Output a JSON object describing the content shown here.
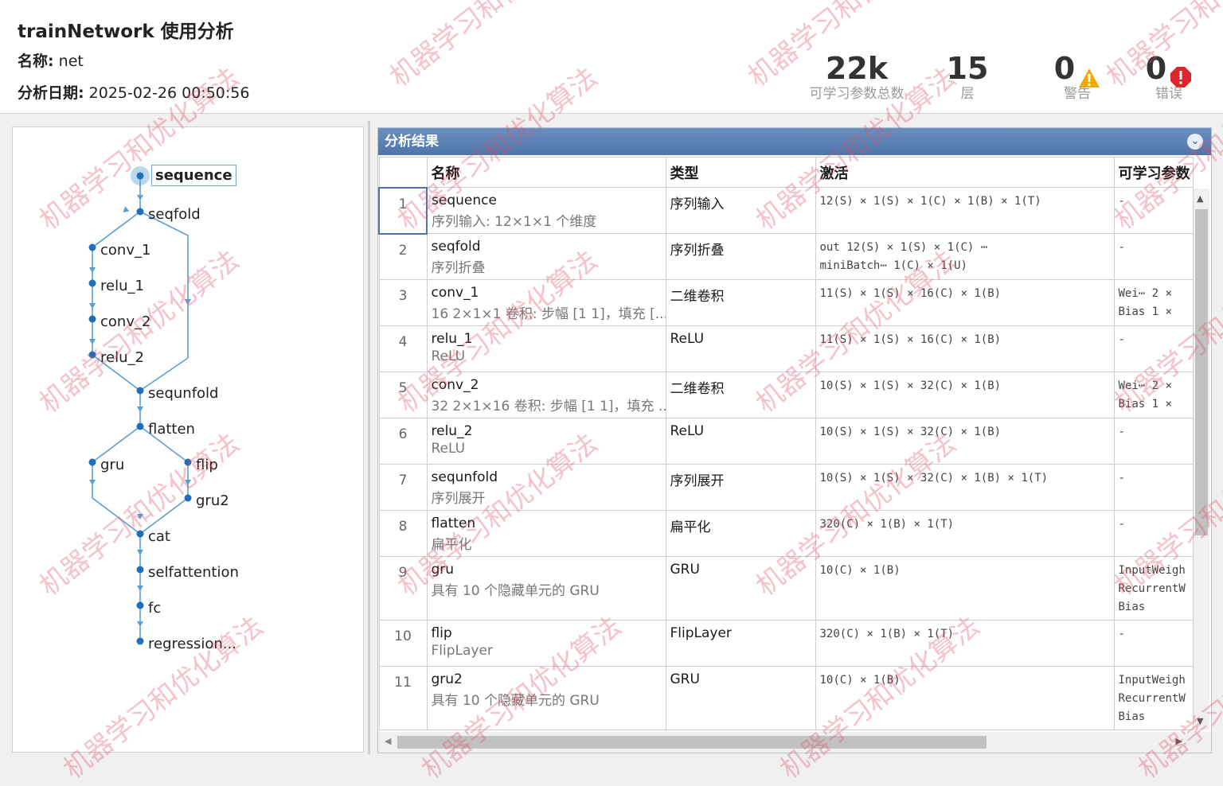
{
  "header": {
    "title": "trainNetwork 使用分析",
    "name_label": "名称:",
    "name_value": "net",
    "date_label": "分析日期:",
    "date_value": "2025-02-26 00:50:56",
    "stats": {
      "params": {
        "value": "22k",
        "label": "可学习参数总数"
      },
      "layers": {
        "value": "15",
        "label": "层"
      },
      "warnings": {
        "value": "0",
        "label": "警告",
        "icon": "warning-triangle-icon",
        "color": "#f2a900"
      },
      "errors": {
        "value": "0",
        "label": "错误",
        "icon": "error-octagon-icon",
        "color": "#d9262b"
      }
    }
  },
  "graph": {
    "nodes": [
      "sequence",
      "seqfold",
      "conv_1",
      "relu_1",
      "conv_2",
      "relu_2",
      "sequnfold",
      "flatten",
      "gru",
      "flip",
      "gru2",
      "cat",
      "selfattention",
      "fc",
      "regression..."
    ],
    "edge_color": "#5a9fd4",
    "selected": "sequence"
  },
  "results": {
    "title": "分析结果",
    "columns": [
      "",
      "名称",
      "类型",
      "激活",
      "可学习参数"
    ],
    "rows": [
      {
        "idx": "1",
        "name": "sequence",
        "desc": "序列输入: 12×1×1 个维度",
        "type": "序列输入",
        "act": [
          "12(S) × 1(S) × 1(C) × 1(B) × 1(T)"
        ],
        "params": [
          "-"
        ]
      },
      {
        "idx": "2",
        "name": "seqfold",
        "desc": "序列折叠",
        "type": "序列折叠",
        "act": [
          "out        12(S) × 1(S) × 1(C) ⋯",
          "miniBatch⋯  1(C) × 1(U)"
        ],
        "params": [
          "-"
        ]
      },
      {
        "idx": "3",
        "name": "conv_1",
        "desc": "16 2×1×1 卷积: 步幅 [1 1]，填充 [...",
        "type": "二维卷积",
        "act": [
          "11(S) × 1(S) × 16(C) × 1(B)"
        ],
        "params": [
          "Wei⋯  2 ×",
          "Bias  1 ×"
        ]
      },
      {
        "idx": "4",
        "name": "relu_1",
        "desc": "ReLU",
        "type": "ReLU",
        "act": [
          "11(S) × 1(S) × 16(C) × 1(B)"
        ],
        "params": [
          "-"
        ]
      },
      {
        "idx": "5",
        "name": "conv_2",
        "desc": "32 2×1×16 卷积: 步幅 [1 1]，填充 ...",
        "type": "二维卷积",
        "act": [
          "10(S) × 1(S) × 32(C) × 1(B)"
        ],
        "params": [
          "Wei⋯  2 ×",
          "Bias  1 ×"
        ]
      },
      {
        "idx": "6",
        "name": "relu_2",
        "desc": "ReLU",
        "type": "ReLU",
        "act": [
          "10(S) × 1(S) × 32(C) × 1(B)"
        ],
        "params": [
          "-"
        ]
      },
      {
        "idx": "7",
        "name": "sequnfold",
        "desc": "序列展开",
        "type": "序列展开",
        "act": [
          "10(S) × 1(S) × 32(C) × 1(B) × 1(T)"
        ],
        "params": [
          "-"
        ]
      },
      {
        "idx": "8",
        "name": "flatten",
        "desc": "扁平化",
        "type": "扁平化",
        "act": [
          "320(C) × 1(B) × 1(T)"
        ],
        "params": [
          "-"
        ]
      },
      {
        "idx": "9",
        "name": "gru",
        "desc": "具有 10 个隐藏单元的 GRU",
        "type": "GRU",
        "act": [
          "10(C) × 1(B)"
        ],
        "params": [
          "InputWeigh",
          "RecurrentW",
          "Bias"
        ]
      },
      {
        "idx": "10",
        "name": "flip",
        "desc": "FlipLayer",
        "type": "FlipLayer",
        "act": [
          "320(C) × 1(B) × 1(T)"
        ],
        "params": [
          "-"
        ]
      },
      {
        "idx": "11",
        "name": "gru2",
        "desc": "具有 10 个隐藏单元的 GRU",
        "type": "GRU",
        "act": [
          "10(C) × 1(B)"
        ],
        "params": [
          "InputWeigh",
          "RecurrentW",
          "Bias"
        ]
      }
    ]
  },
  "watermark": "机器学习和优化算法"
}
